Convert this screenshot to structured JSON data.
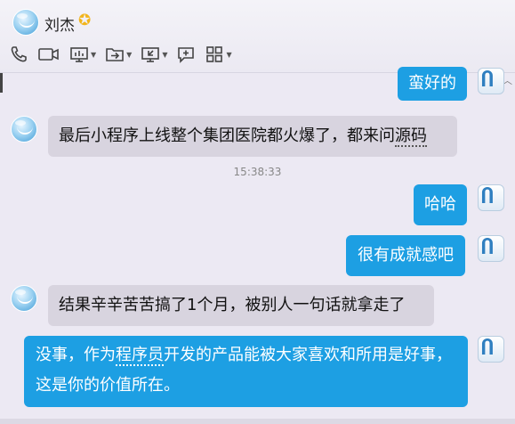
{
  "contact": {
    "name": "刘杰",
    "badge_icon": "star-icon"
  },
  "toolbar": {
    "items": [
      {
        "icon": "phone-icon"
      },
      {
        "icon": "video-icon"
      },
      {
        "icon": "screen-share-icon"
      },
      {
        "icon": "folder-transfer-icon"
      },
      {
        "icon": "remote-assist-icon"
      },
      {
        "icon": "add-message-icon"
      },
      {
        "icon": "apps-grid-icon"
      }
    ]
  },
  "messages": [
    {
      "side": "right",
      "text": "蛮好的"
    },
    {
      "side": "left",
      "text_before": "最后小程序上线整个集团医院都火爆了，都来问",
      "text_dotted": "源码",
      "text_after": ""
    },
    {
      "side": "right",
      "text": "哈哈"
    },
    {
      "side": "right",
      "text": "很有成就感吧"
    },
    {
      "side": "left",
      "text": "结果辛辛苦苦搞了1个月，被别人一句话就拿走了"
    },
    {
      "side": "right",
      "text_before": "没事，作为",
      "text_dotted": "程序员",
      "text_after": "开发的产品能被大家喜欢和所用是好事，这是你的价值所在。"
    }
  ],
  "timestamp": "15:38:33",
  "me_avatar_glyph": "Ⴖ",
  "colors": {
    "outgoing_bubble": "#1d9fe3",
    "incoming_bubble": "#d8d4df",
    "background": "#ece9f3"
  }
}
